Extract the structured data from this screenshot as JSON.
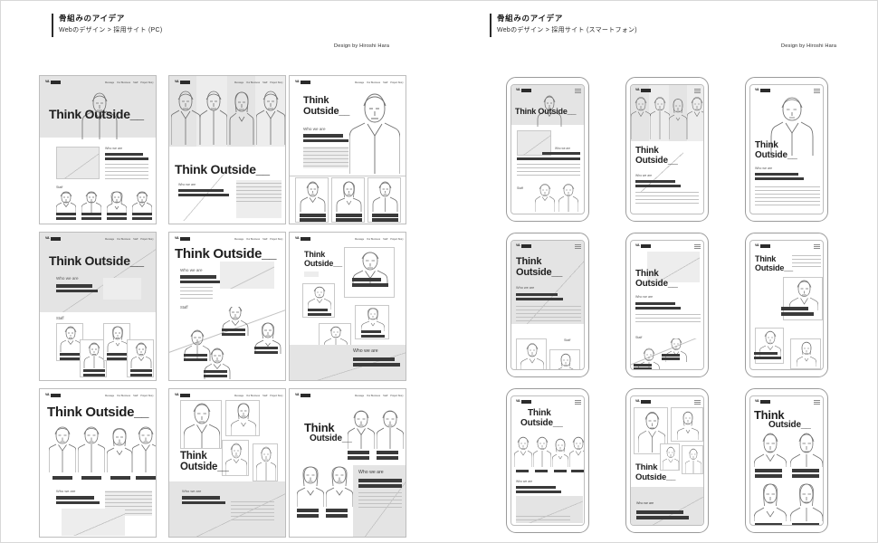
{
  "page": {
    "bg_color": "#ffffff",
    "border_color": "#d8d8d8"
  },
  "left_header": {
    "title": "骨組みのアイデア",
    "subtitle": "Webのデザイン > 採用サイト (PC)",
    "credit": "Design by Hiroshi Hara"
  },
  "right_header": {
    "title": "骨組みのアイデア",
    "subtitle": "Webのデザイン > 採用サイト (スマートフォン)",
    "credit": "Design by Hiroshi Hara"
  },
  "wireframe": {
    "logo_text": "VA",
    "nav_items": [
      "Message",
      "Our Business",
      "Staff",
      "Project Story",
      "Recruit Info"
    ],
    "headline": "Think Outside__",
    "headline_line1": "Think",
    "headline_line2": "Outside__",
    "section_who": "Who we are",
    "section_staff": "Staff",
    "menu_icon": "hamburger-menu-icon"
  },
  "colors": {
    "ink": "#1f1f1f",
    "bar_dark": "#3a3a3a",
    "panel_gray": "#e4e4e4",
    "panel_light": "#ededed",
    "line_gray": "#c2c2c2",
    "frame_border": "#bdbdbd",
    "phone_border": "#9b9b9b"
  },
  "pc_layouts": [
    {
      "id": "pc-1",
      "name": "hero-center-portrait-over-gray"
    },
    {
      "id": "pc-2",
      "name": "four-portraits-top-headline-below"
    },
    {
      "id": "pc-3",
      "name": "headline-left-portrait-right-three-cards"
    },
    {
      "id": "pc-4",
      "name": "headline-top-gray-staff-grid-offset"
    },
    {
      "id": "pc-5",
      "name": "headline-top-diagonal-staff-cascade"
    },
    {
      "id": "pc-6",
      "name": "headline-left-card-collage-who-bottom"
    },
    {
      "id": "pc-7",
      "name": "headline-top-four-portraits-row"
    },
    {
      "id": "pc-8",
      "name": "portrait-collage-top-headline-middle"
    },
    {
      "id": "pc-9",
      "name": "headline-left-portraits-who-panel-right"
    }
  ],
  "sp_layouts": [
    {
      "id": "sp-1",
      "name": "hero-portrait-image-who-staff"
    },
    {
      "id": "sp-2",
      "name": "four-portraits-headline-below"
    },
    {
      "id": "sp-3",
      "name": "large-portrait-headline-overlay"
    },
    {
      "id": "sp-4",
      "name": "headline-top-text-staff-cards-bottom"
    },
    {
      "id": "sp-5",
      "name": "image-block-headline-staff-diagonal"
    },
    {
      "id": "sp-6",
      "name": "headline-lines-portrait-cards"
    },
    {
      "id": "sp-7",
      "name": "headline-four-portraits-who-gray"
    },
    {
      "id": "sp-8",
      "name": "portrait-collage-headline-who-bottom"
    },
    {
      "id": "sp-9",
      "name": "headline-top-four-large-portraits"
    }
  ]
}
